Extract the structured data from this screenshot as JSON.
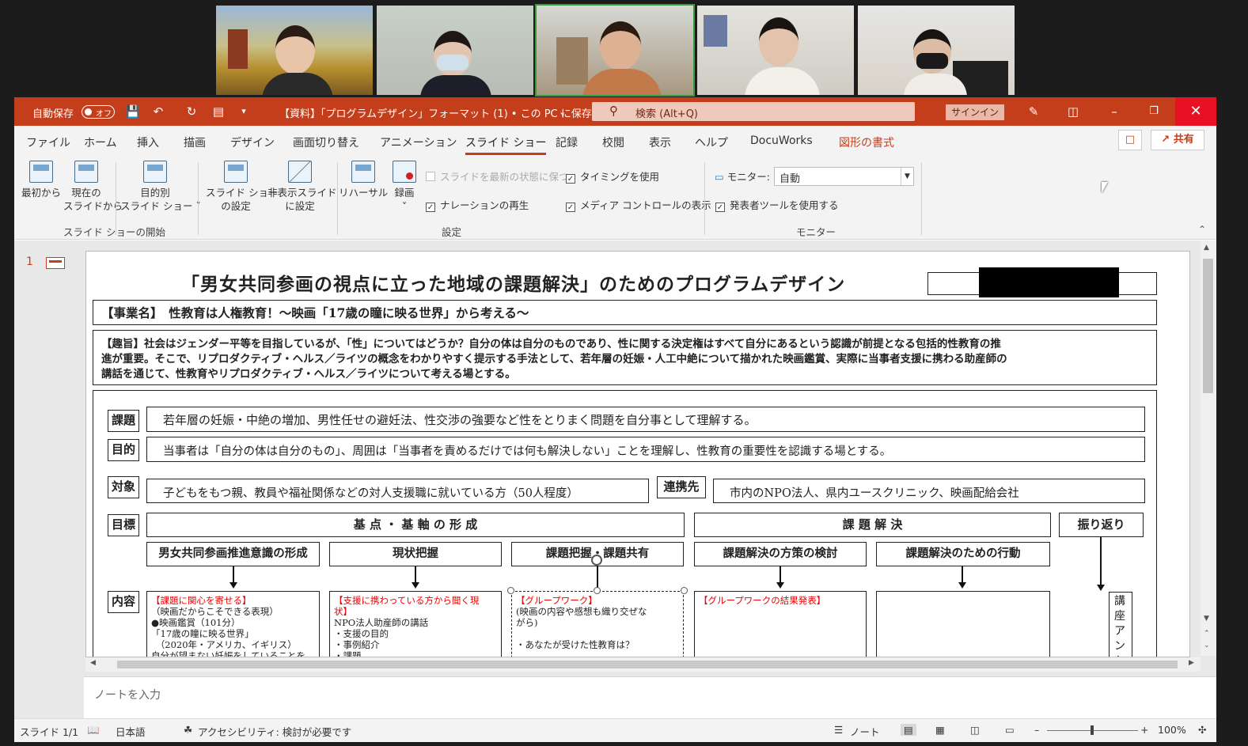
{
  "colors": {
    "accent": "#c43e1c",
    "close": "#e81123"
  },
  "titlebar": {
    "autosave_label": "自動保存",
    "autosave_state": "オフ",
    "document_title": "【資料】「プログラムデザイン」フォーマット (1) • この PC に保存済み",
    "search_placeholder": "検索 (Alt+Q)",
    "signin_label": "サインイン"
  },
  "tabs": [
    "ファイル",
    "ホーム",
    "挿入",
    "描画",
    "デザイン",
    "画面切り替え",
    "アニメーション",
    "スライド ショー",
    "記録",
    "校閲",
    "表示",
    "ヘルプ",
    "DocuWorks",
    "図形の書式"
  ],
  "share_label": "共有",
  "ribbon": {
    "from_start": [
      "最初から",
      ""
    ],
    "from_current": [
      "現在の",
      "スライドから"
    ],
    "custom": [
      "目的別",
      "スライド ショー ˅"
    ],
    "group_start": "スライド ショーの開始",
    "setup": [
      "スライド ショー",
      "の設定"
    ],
    "hide": [
      "非表示スライド",
      "に設定"
    ],
    "rehearse": "リハーサル",
    "record": [
      "録画",
      "˅"
    ],
    "keep_fresh": "スライドを最新の状態に保つ",
    "narration": "ナレーションの再生",
    "use_timings": "タイミングを使用",
    "media_controls": "メディア コントロールの表示",
    "group_setup": "設定",
    "monitor_label": "モニター:",
    "monitor_value": "自動",
    "presenter_view": "発表者ツールを使用する",
    "group_monitor": "モニター"
  },
  "slide_number": "1",
  "slide": {
    "title": "「男女共同参画の視点に立った地域の課題解決」のためのプログラムデザイン",
    "project_name": "【事業名】　性教育は人権教育！～映画「17歳の瞳に映る世界」から考える～",
    "purpose_lines": [
      "【趣旨】社会はジェンダー平等を目指しているが、｢性」についてはどうか？自分の体は自分のものであり、性に関する決定権はすべて自分にあるという認識が前提となる包括的性教育の推",
      "進が重要。そこで、リプロダクティブ・ヘルス／ライツの概念をわかりやすく提示する手法として、若年層の妊娠・人工中絶について描かれた映画鑑賞、実際に当事者支援に携わる助産師の",
      "講話を通じて、性教育やリプロダクティブ・ヘルス／ライツについて考える場とする。"
    ],
    "label_issue": "課題",
    "issue_text": "若年層の妊娠・中絶の増加、男性任せの避妊法、性交渉の強要など性をとりまく問題を自分事として理解する。",
    "label_goal": "目的",
    "goal_text": "当事者は「自分の体は自分のもの」、周囲は「当事者を責めるだけでは何も解決しない」ことを理解し、性教育の重要性を認識する場とする。",
    "label_target": "対象",
    "target_text": "子どもをもつ親、教員や福祉関係などの対人支援職に就いている方（50人程度）",
    "label_partner": "連携先",
    "partner_text": "市内のNPO法人、県内ユースクリニック、映画配給会社",
    "label_objective": "目標",
    "hdr_base": "基 点 ・ 基 軸 の 形 成",
    "hdr_solve": "課 題 解 決",
    "hdr_review": "振り返り",
    "sub1": "男女共同参画推進意識の形成",
    "sub2": "現状把握",
    "sub3": "課題把握・課題共有",
    "sub4": "課題解決の方策の検討",
    "sub5": "課題解決のための行動",
    "label_content": "内容",
    "c1_head": "【課題に関心を寄せる】",
    "c1_body": "（映画だからこそできる表現）\n●映画鑑賞（101分）\n 「17歳の瞳に映る世界」\n 　（2020年・アメリカ、イギリス）\n自分が望まない妊娠をしていることを",
    "c2_head": "【支援に携わっている方から聞く現状】",
    "c2_body": "NPO法人助産師の講話\n・支援の目的\n・事例紹介\n・課題",
    "c3_head": "【グループワーク】",
    "c3_body": " (映画の内容や感想も織り交ぜな\nがら)\n\n・あなたが受けた性教育は？",
    "c4_head": "【グループワークの結果発表】",
    "c6_text": "講座アンケ"
  },
  "notes_placeholder": "ノートを入力",
  "status": {
    "slide_count": "スライド 1/1",
    "language": "日本語",
    "accessibility": "アクセシビリティ: 検討が必要です",
    "notes_btn": "ノート",
    "zoom": "100%"
  }
}
